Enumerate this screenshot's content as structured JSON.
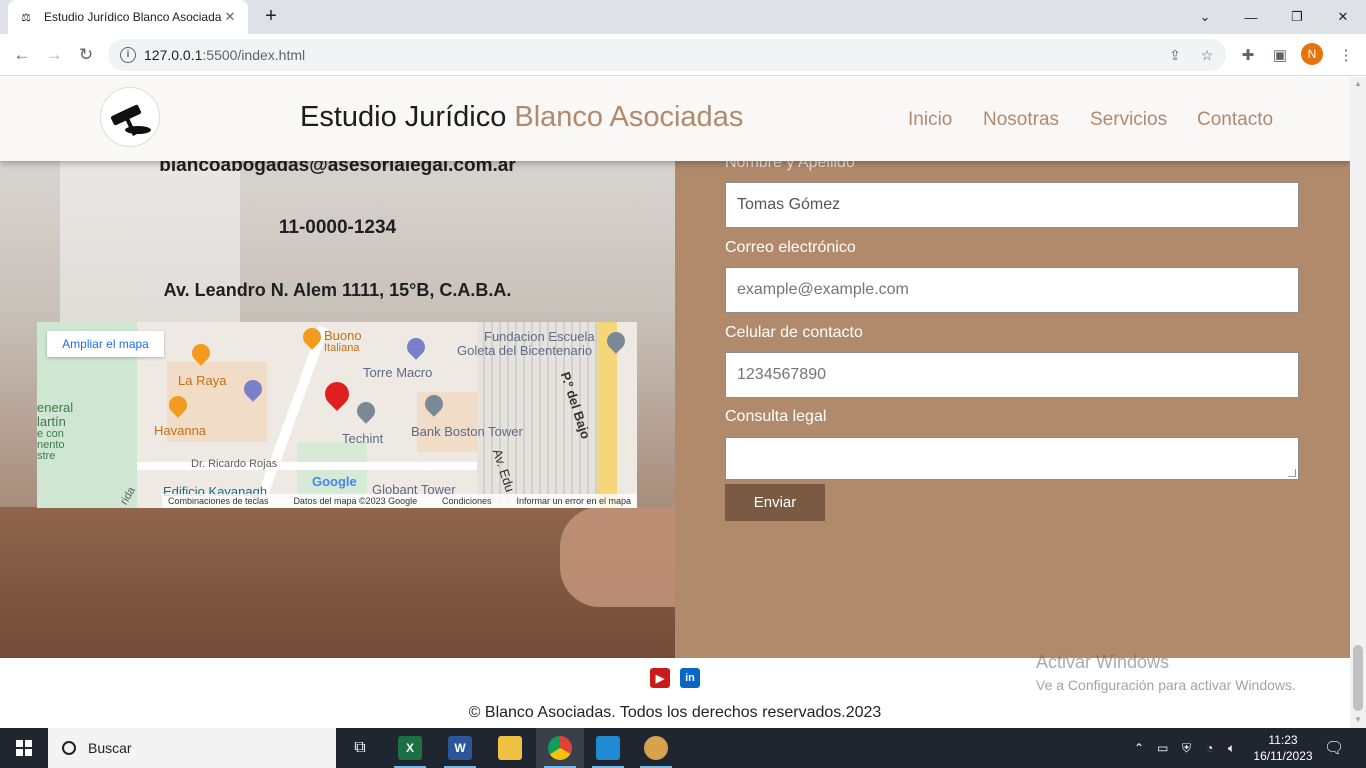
{
  "browser": {
    "tab_title": "Estudio Jurídico Blanco Asociadas",
    "tab_favicon": "gavel-icon",
    "new_tab_symbol": "+",
    "url_host": "127.0.0.1",
    "url_path": ":5500/index.html",
    "avatar_letter": "N",
    "controls": {
      "dropdown": "⌄",
      "minimize": "—",
      "restore": "❐",
      "close": "✕"
    }
  },
  "header": {
    "brand_main": "Estudio Jurídico",
    "brand_accent": "Blanco Asociadas",
    "nav": [
      "Inicio",
      "Nosotras",
      "Servicios",
      "Contacto"
    ],
    "accent_color": "#b18a6c"
  },
  "contact": {
    "email": "blancoabogadas@asesorialegal.com.ar",
    "phone": "11-0000-1234",
    "address": "Av. Leandro N. Alem 1111, 15°B, C.A.B.A."
  },
  "map": {
    "enlarge_button": "Ampliar el mapa",
    "labels": {
      "buono": "Buono",
      "italiana": "Italiana",
      "fundacion_1": "Fundacion Escuela",
      "fundacion_2": "Goleta del Bicentenario",
      "torre_macro": "Torre Macro",
      "la_raya": "La Raya",
      "general": "eneral",
      "martin": "lartín",
      "ecn": "e con",
      "mento": "nento",
      "stre": "stre",
      "havanna": "Havanna",
      "techint": "Techint",
      "bank_boston": "Bank Boston Tower",
      "paseo_bajo": "P.º del Bajo",
      "ricardo_rojas": "Dr. Ricardo Rojas",
      "edificio_kavanagh": "Edificio Kavanagh",
      "globant_tower": "Globant Tower",
      "av_edu": "Av. Edu",
      "rida": "rida"
    },
    "google": "Google",
    "footer": {
      "shortcuts": "Combinaciones de teclas",
      "data": "Datos del mapa ©2023 Google",
      "terms": "Condiciones",
      "report": "Informar un error en el mapa"
    }
  },
  "form": {
    "name_label": "Nombre y Apellido",
    "name_value": "Tomas Gómez",
    "email_label": "Correo electrónico",
    "email_placeholder": "example@example.com",
    "phone_label": "Celular de contacto",
    "phone_placeholder": "1234567890",
    "query_label": "Consulta legal",
    "submit_label": "Enviar"
  },
  "footer": {
    "social": [
      "youtube-icon",
      "linkedin-icon"
    ],
    "linkedin_text": "in",
    "copyright": "© Blanco Asociadas. Todos los derechos reservados.2023",
    "watermark_title": "Activar Windows",
    "watermark_sub": "Ve a Configuración para activar Windows."
  },
  "taskbar": {
    "search_label": "Buscar",
    "time": "11:23",
    "date": "16/11/2023",
    "apps": [
      "task-view-icon",
      "excel-icon",
      "word-icon",
      "file-explorer-icon",
      "chrome-icon",
      "vscode-icon",
      "paint-icon"
    ],
    "excel_letter": "X",
    "word_letter": "W"
  }
}
